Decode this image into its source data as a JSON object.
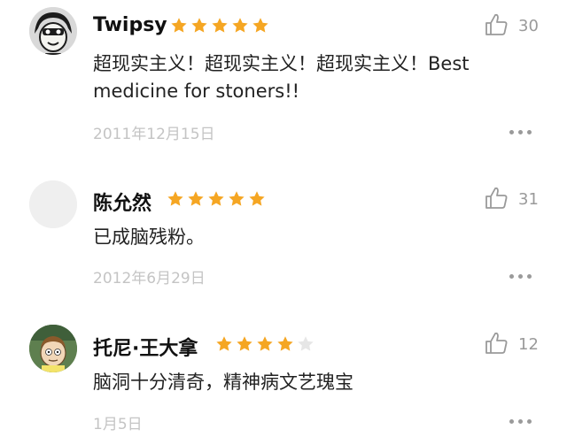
{
  "colors": {
    "star_filled": "#F5A623",
    "star_empty": "#E6E6E6",
    "muted": "#9A9A9A",
    "date": "#C4C4C4"
  },
  "reviews": [
    {
      "user": "Twipsy",
      "rating": 5,
      "likes": "30",
      "content": "超现实主义！超现实主义！超现实主义！Best medicine for stoners!!",
      "date": "2011年12月15日",
      "avatar_icon": "cartoon-avatar-icon"
    },
    {
      "user": "陈允然",
      "rating": 5,
      "likes": "31",
      "content": "已成脑残粉。",
      "date": "2012年6月29日",
      "avatar_icon": "default-avatar-icon"
    },
    {
      "user": "托尼·王大拿",
      "rating": 4,
      "likes": "12",
      "content": "脑洞十分清奇，精神病文艺瑰宝",
      "date": "1月5日",
      "avatar_icon": "cartoon-avatar-icon"
    }
  ]
}
